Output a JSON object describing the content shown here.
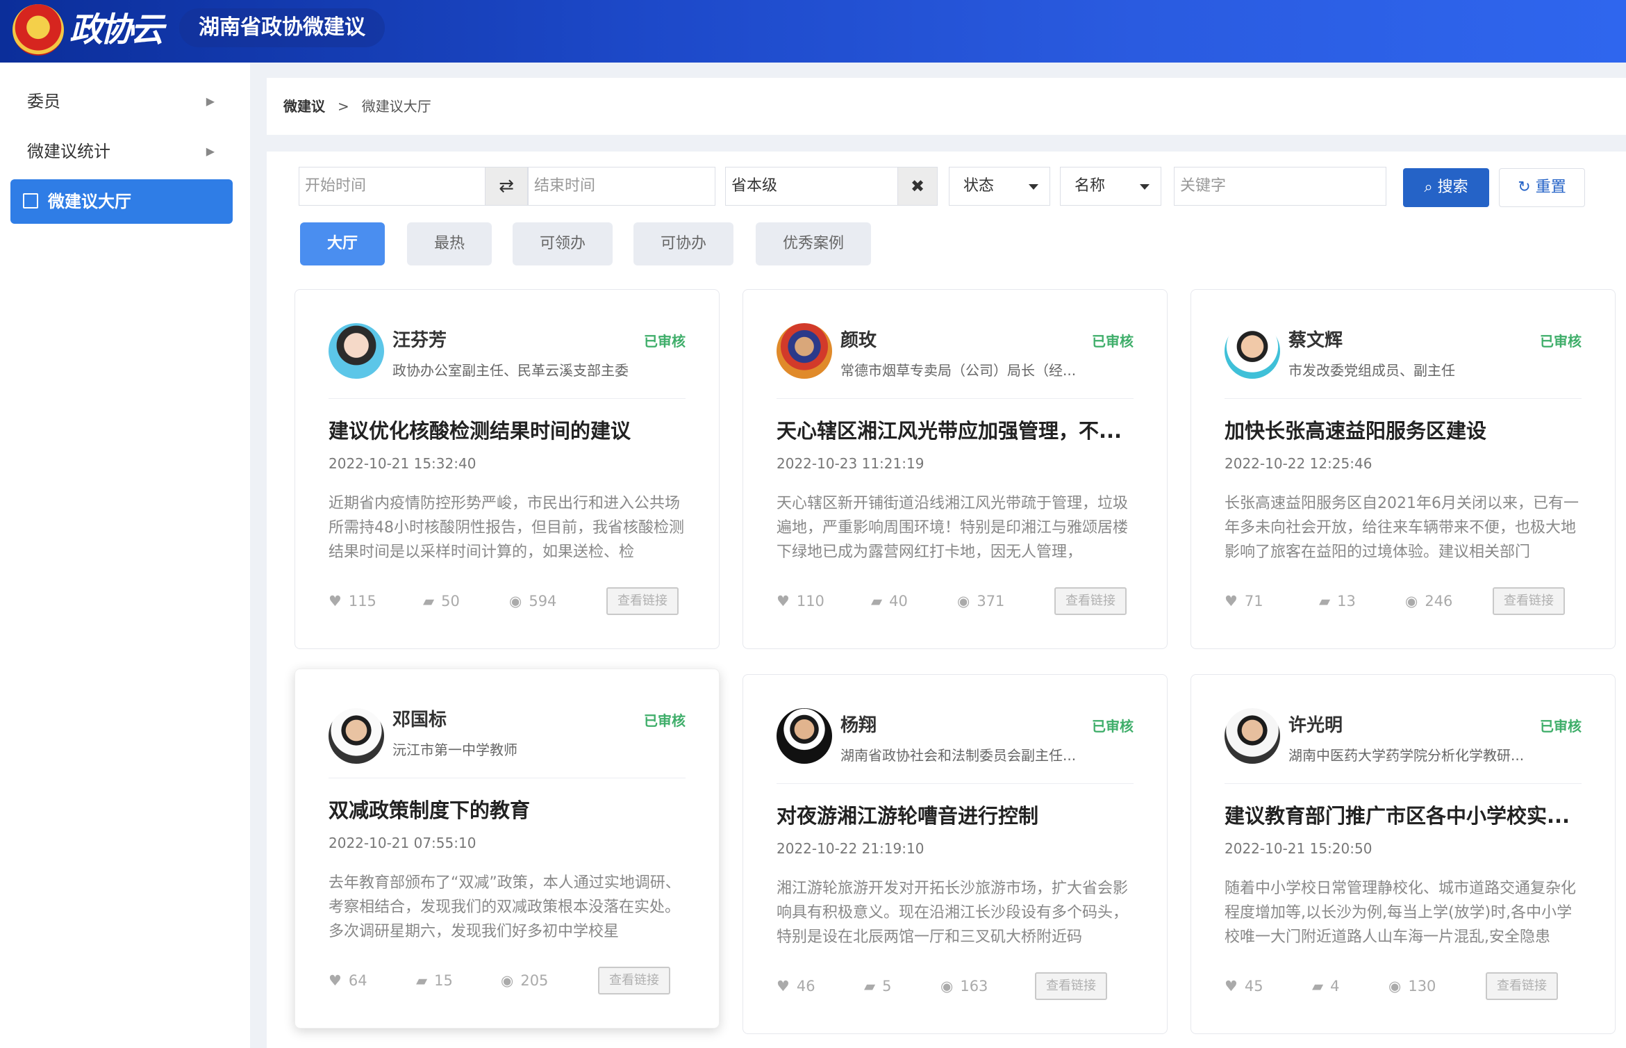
{
  "header": {
    "logo_text": "政协云",
    "app_title": "湖南省政协微建议"
  },
  "sidebar": {
    "items": [
      {
        "label": "委员",
        "has_arrow": true
      },
      {
        "label": "微建议统计",
        "has_arrow": true
      },
      {
        "label": "微建议大厅",
        "active": true
      }
    ]
  },
  "breadcrumb": {
    "root": "微建议",
    "separator": ">",
    "current": "微建议大厅"
  },
  "filters": {
    "start_placeholder": "开始时间",
    "end_placeholder": "结束时间",
    "region_value": "省本级",
    "status_label": "状态",
    "name_label": "名称",
    "keyword_placeholder": "关键字",
    "search_label": "搜索",
    "reset_label": "重置"
  },
  "tabs": [
    {
      "label": "大厅",
      "active": true
    },
    {
      "label": "最热"
    },
    {
      "label": "可领办"
    },
    {
      "label": "可协办"
    },
    {
      "label": "优秀案例"
    }
  ],
  "cards": [
    {
      "name": "汪芬芳",
      "role": "政协办公室副主任、民革云溪支部主委",
      "status": "已审核",
      "title": "建议优化核酸检测结果时间的建议",
      "time": "2022-10-21 15:32:40",
      "body": "近期省内疫情防控形势严峻，市民出行和进入公共场所需持48小时核酸阴性报告，但目前，我省核酸检测结果时间是以采样时间计算的，如果送检、检",
      "likes": "115",
      "comments": "50",
      "views": "594",
      "link_label": "查看链接"
    },
    {
      "name": "颜玫",
      "role": "常德市烟草专卖局（公司）局长（经...",
      "status": "已审核",
      "title": "天心辖区湘江风光带应加强管理，不...",
      "time": "2022-10-23 11:21:19",
      "body": "天心辖区新开铺街道沿线湘江风光带疏于管理，垃圾遍地，严重影响周围环境！特别是印湘江与雅颂居楼下绿地已成为露营网红打卡地，因无人管理，",
      "likes": "110",
      "comments": "40",
      "views": "371",
      "link_label": "查看链接"
    },
    {
      "name": "蔡文辉",
      "role": "市发改委党组成员、副主任",
      "status": "已审核",
      "title": "加快长张高速益阳服务区建设",
      "time": "2022-10-22 12:25:46",
      "body": "长张高速益阳服务区自2021年6月关闭以来，已有一年多未向社会开放，给往来车辆带来不便，也极大地影响了旅客在益阳的过境体验。建议相关部门",
      "likes": "71",
      "comments": "13",
      "views": "246",
      "link_label": "查看链接"
    },
    {
      "name": "邓国标",
      "role": "沅江市第一中学教师",
      "status": "已审核",
      "title": "双减政策制度下的教育",
      "time": "2022-10-21 07:55:10",
      "body": "去年教育部颁布了“双减”政策，本人通过实地调研、考察相结合，发现我们的双减政策根本没落在实处。多次调研星期六，发现我们好多初中学校星",
      "likes": "64",
      "comments": "15",
      "views": "205",
      "link_label": "查看链接"
    },
    {
      "name": "杨翔",
      "role": "湖南省政协社会和法制委员会副主任...",
      "status": "已审核",
      "title": "对夜游湘江游轮嘈音进行控制",
      "time": "2022-10-22 21:19:10",
      "body": "湘江游轮旅游开发对开拓长沙旅游市场，扩大省会影响具有积极意义。现在沿湘江长沙段设有多个码头，特别是设在北辰两馆一厅和三叉矶大桥附近码",
      "likes": "46",
      "comments": "5",
      "views": "163",
      "link_label": "查看链接"
    },
    {
      "name": "许光明",
      "role": "湖南中医药大学药学院分析化学教研...",
      "status": "已审核",
      "title": "建议教育部门推广市区各中小学校实...",
      "time": "2022-10-21 15:20:50",
      "body": "随着中小学校日常管理静校化、城市道路交通复杂化程度增加等,以长沙为例,每当上学(放学)时,各中小学校唯一大门附近道路人山车海一片混乱,安全隐患",
      "likes": "45",
      "comments": "4",
      "views": "130",
      "link_label": "查看链接"
    }
  ],
  "colors": {
    "header": "#1d49c9",
    "primary": "#2563c7",
    "active_tab": "#4a8ef0",
    "approved": "#3fae6a"
  }
}
